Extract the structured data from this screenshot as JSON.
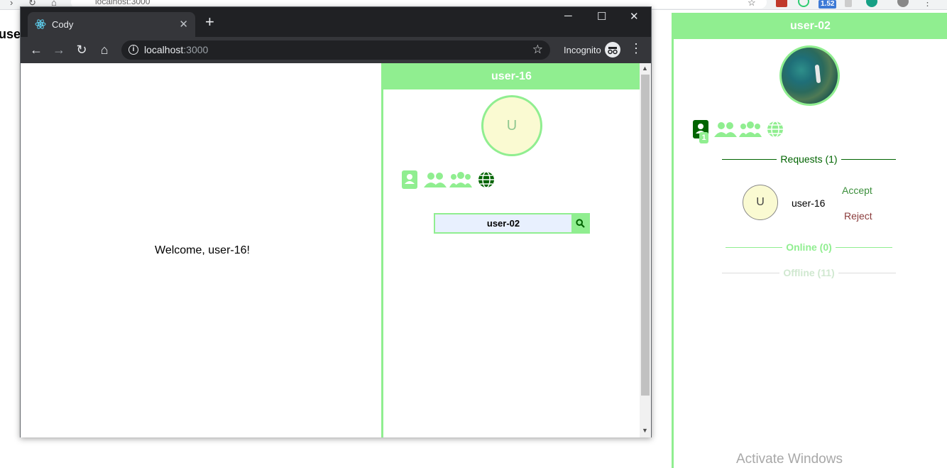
{
  "outer_browser": {
    "url": "localhost:3000",
    "extension_badge": "1.52"
  },
  "background_page": {
    "partial_username": "user"
  },
  "outer_panel": {
    "username": "user-02",
    "requests_label": "Requests (1)",
    "request_badge_count": "1",
    "requests": [
      {
        "avatar_letter": "U",
        "username": "user-16",
        "accept_label": "Accept",
        "reject_label": "Reject"
      }
    ],
    "online_label": "Online (0)",
    "offline_label": "Offline (11)"
  },
  "watermark": "Activate Windows",
  "inner_browser": {
    "tab_title": "Cody",
    "url_host": "localhost",
    "url_port": ":3000",
    "incognito_label": "Incognito",
    "window_controls": {
      "minimize": "─",
      "maximize": "☐",
      "close": "✕"
    },
    "new_tab": "+",
    "tab_close": "✕"
  },
  "inner_app": {
    "welcome_text": "Welcome, user-16!",
    "panel_username": "user-16",
    "avatar_letter": "U",
    "search_value": "user-02"
  },
  "colors": {
    "accent": "#90ee90",
    "accent_dark": "#006400",
    "avatar_bg": "#fafad2",
    "accept": "#3c8f3c",
    "reject": "#8b3c3c"
  },
  "icons": [
    "contact-book-icon",
    "user-friends-icon",
    "users-group-icon",
    "globe-icon",
    "search-icon",
    "react-logo-icon",
    "incognito-icon"
  ]
}
